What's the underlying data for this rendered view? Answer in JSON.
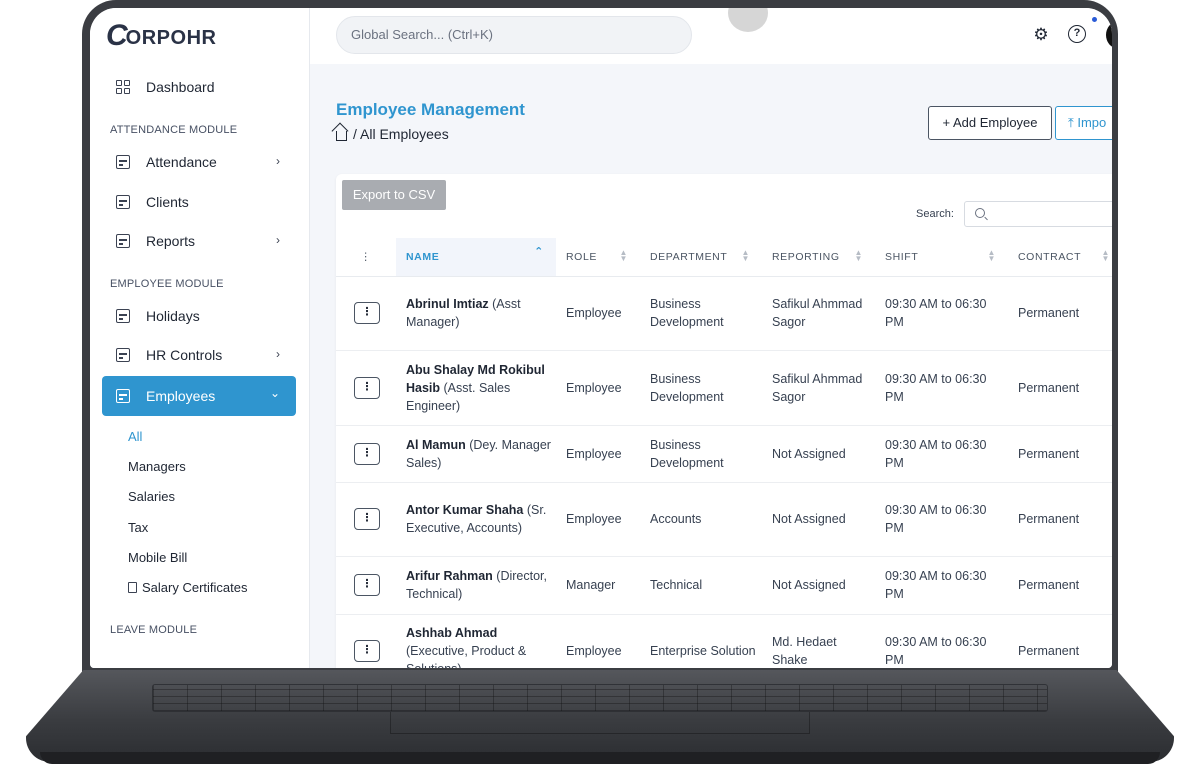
{
  "app": {
    "logo_mark": "C",
    "logo_text_orpo": "ORPO",
    "logo_text_hr": "HR"
  },
  "topbar": {
    "search_placeholder": "Global Search... (Ctrl+K)",
    "settings_icon": "gear-icon",
    "help_glyph": "?",
    "notification_color": "#2a5bd7"
  },
  "sidebar": {
    "dashboard": "Dashboard",
    "attendance_module": "ATTENDANCE MODULE",
    "attendance": "Attendance",
    "clients": "Clients",
    "reports": "Reports",
    "employee_module": "EMPLOYEE MODULE",
    "holidays": "Holidays",
    "hr_controls": "HR Controls",
    "employees": "Employees",
    "sub_items": [
      "All",
      "Managers",
      "Salaries",
      "Tax",
      "Mobile Bill",
      "Salary Certificates"
    ],
    "leave_module": "LEAVE MODULE",
    "chevron_right": "›",
    "chevron_down": "⌄"
  },
  "page": {
    "title": "Employee Management",
    "breadcrumb": "/ All Employees",
    "add_button": "+ Add Employee",
    "import_button": "⤒ Impo"
  },
  "table": {
    "export_button": "Export to CSV",
    "search_label": "Search:",
    "menu_glyph": "⋮",
    "headers": [
      "NAME",
      "ROLE",
      "DEPARTMENT",
      "REPORTING",
      "SHIFT",
      "CONTRACT"
    ],
    "rows": [
      {
        "name": "Abrinul Imtiaz",
        "title": " (Asst Manager)",
        "role": "Employee",
        "department": "Business Development",
        "reporting": "Safikul Ahmmad Sagor",
        "shift": "09:30 AM to 06:30 PM",
        "contract": "Permanent"
      },
      {
        "name": "Abu Shalay Md Rokibul Hasib",
        "title": " (Asst. Sales Engineer)",
        "role": "Employee",
        "department": "Business Development",
        "reporting": "Safikul Ahmmad Sagor",
        "shift": "09:30 AM to 06:30 PM",
        "contract": "Permanent"
      },
      {
        "name": "Al Mamun",
        "title": " (Dey. Manager Sales)",
        "role": "Employee",
        "department": "Business Development",
        "reporting": "Not Assigned",
        "shift": "09:30 AM to 06:30 PM",
        "contract": "Permanent"
      },
      {
        "name": "Antor Kumar Shaha",
        "title": " (Sr. Executive, Accounts)",
        "role": "Employee",
        "department": "Accounts",
        "reporting": "Not Assigned",
        "shift": "09:30 AM to 06:30 PM",
        "contract": "Permanent"
      },
      {
        "name": "Arifur Rahman",
        "title": " (Director, Technical)",
        "role": "Manager",
        "department": "Technical",
        "reporting": "Not Assigned",
        "shift": "09:30 AM to 06:30 PM",
        "contract": "Permanent"
      },
      {
        "name": "Ashhab Ahmad",
        "title": " (Executive, Product & Solutions)",
        "role": "Employee",
        "department": "Enterprise Solution",
        "reporting": "Md. Hedaet Shake",
        "shift": "09:30 AM to 06:30 PM",
        "contract": "Permanent"
      }
    ]
  },
  "colors": {
    "accent": "#2f95cf",
    "frame": "#3b3d42"
  }
}
